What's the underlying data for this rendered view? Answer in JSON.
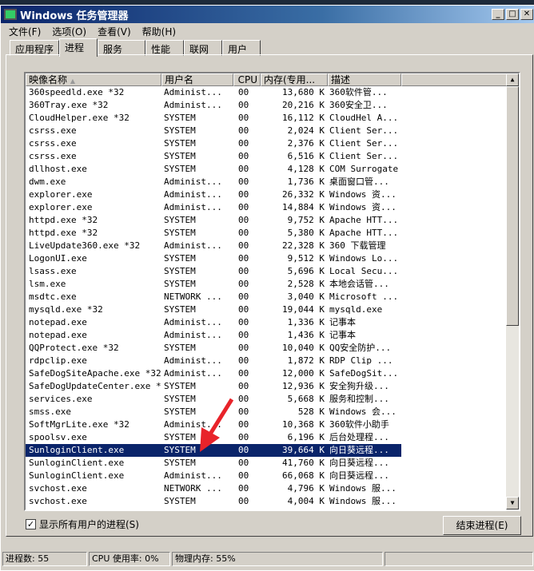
{
  "window": {
    "title": "Windows 任务管理器"
  },
  "menu": [
    "文件(F)",
    "选项(O)",
    "查看(V)",
    "帮助(H)"
  ],
  "tabs": [
    "应用程序",
    "进程",
    "服务",
    "性能",
    "联网",
    "用户"
  ],
  "columns": [
    "映像名称",
    "用户名",
    "CPU",
    "内存(专用...",
    "描述"
  ],
  "processes": [
    [
      "360speedld.exe *32",
      "Administ...",
      "00",
      "13,680 K",
      "360软件管..."
    ],
    [
      "360Tray.exe *32",
      "Administ...",
      "00",
      "20,216 K",
      "360安全卫..."
    ],
    [
      "CloudHelper.exe *32",
      "SYSTEM",
      "00",
      "16,112 K",
      "CloudHel A..."
    ],
    [
      "csrss.exe",
      "SYSTEM",
      "00",
      "2,024 K",
      "Client Ser..."
    ],
    [
      "csrss.exe",
      "SYSTEM",
      "00",
      "2,376 K",
      "Client Ser..."
    ],
    [
      "csrss.exe",
      "SYSTEM",
      "00",
      "6,516 K",
      "Client Ser..."
    ],
    [
      "dllhost.exe",
      "SYSTEM",
      "00",
      "4,128 K",
      "COM Surrogate"
    ],
    [
      "dwm.exe",
      "Administ...",
      "00",
      "1,736 K",
      "桌面窗口管..."
    ],
    [
      "explorer.exe",
      "Administ...",
      "00",
      "26,332 K",
      "Windows 资..."
    ],
    [
      "explorer.exe",
      "Administ...",
      "00",
      "14,884 K",
      "Windows 资..."
    ],
    [
      "httpd.exe *32",
      "SYSTEM",
      "00",
      "9,752 K",
      "Apache HTT..."
    ],
    [
      "httpd.exe *32",
      "SYSTEM",
      "00",
      "5,380 K",
      "Apache HTT..."
    ],
    [
      "LiveUpdate360.exe *32",
      "Administ...",
      "00",
      "22,328 K",
      "360 下载管理"
    ],
    [
      "LogonUI.exe",
      "SYSTEM",
      "00",
      "9,512 K",
      "Windows Lo..."
    ],
    [
      "lsass.exe",
      "SYSTEM",
      "00",
      "5,696 K",
      "Local Secu..."
    ],
    [
      "lsm.exe",
      "SYSTEM",
      "00",
      "2,528 K",
      "本地会话管..."
    ],
    [
      "msdtc.exe",
      "NETWORK ...",
      "00",
      "3,040 K",
      "Microsoft ..."
    ],
    [
      "mysqld.exe *32",
      "SYSTEM",
      "00",
      "19,044 K",
      "mysqld.exe"
    ],
    [
      "notepad.exe",
      "Administ...",
      "00",
      "1,336 K",
      "记事本"
    ],
    [
      "notepad.exe",
      "Administ...",
      "00",
      "1,436 K",
      "记事本"
    ],
    [
      "QQProtect.exe *32",
      "SYSTEM",
      "00",
      "10,040 K",
      "QQ安全防护..."
    ],
    [
      "rdpclip.exe",
      "Administ...",
      "00",
      "1,872 K",
      "RDP Clip ..."
    ],
    [
      "SafeDogSiteApache.exe *32",
      "Administ...",
      "00",
      "12,000 K",
      "SafeDogSit..."
    ],
    [
      "SafeDogUpdateCenter.exe *32",
      "SYSTEM",
      "00",
      "12,936 K",
      "安全狗升级..."
    ],
    [
      "services.exe",
      "SYSTEM",
      "00",
      "5,668 K",
      "服务和控制..."
    ],
    [
      "smss.exe",
      "SYSTEM",
      "00",
      "528 K",
      "Windows 会..."
    ],
    [
      "SoftMgrLite.exe *32",
      "Administ...",
      "00",
      "10,368 K",
      "360软件小助手"
    ],
    [
      "spoolsv.exe",
      "SYSTEM",
      "00",
      "6,196 K",
      "后台处理程..."
    ],
    [
      "SunloginClient.exe",
      "SYSTEM",
      "00",
      "39,664 K",
      "向日葵远程..."
    ],
    [
      "SunloginClient.exe",
      "SYSTEM",
      "00",
      "41,760 K",
      "向日葵远程..."
    ],
    [
      "SunloginClient.exe",
      "Administ...",
      "00",
      "66,068 K",
      "向日葵远程..."
    ],
    [
      "svchost.exe",
      "NETWORK ...",
      "00",
      "4,796 K",
      "Windows 服..."
    ],
    [
      "svchost.exe",
      "SYSTEM",
      "00",
      "4,004 K",
      "Windows 服..."
    ]
  ],
  "selected_index": 28,
  "show_all_users": {
    "label": "显示所有用户的进程(S)",
    "checked": true
  },
  "end_process_label": "结束进程(E)",
  "status": {
    "processes": "进程数: 55",
    "cpu": "CPU 使用率: 0%",
    "memory": "物理内存: 55%"
  }
}
